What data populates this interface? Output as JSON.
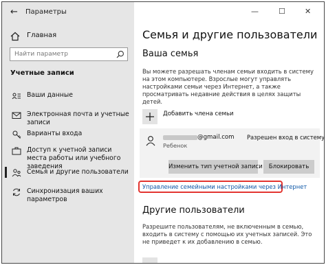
{
  "window": {
    "title": "Параметры",
    "controls": {
      "minimize": "—",
      "maximize": "☐",
      "close": "✕"
    }
  },
  "sidebar": {
    "home_label": "Главная",
    "search_placeholder": "Найти параметр",
    "section_label": "Учетные записи",
    "items": [
      {
        "label": "Ваши данные",
        "icon": "person-card-icon"
      },
      {
        "label": "Электронная почта и учетные записи",
        "icon": "mail-icon"
      },
      {
        "label": "Варианты входа",
        "icon": "key-icon"
      },
      {
        "label": "Доступ к учетной записи места работы или учебного заведения",
        "icon": "briefcase-icon"
      },
      {
        "label": "Семья и другие пользователи",
        "icon": "family-icon",
        "active": true
      },
      {
        "label": "Синхронизация ваших параметров",
        "icon": "sync-icon"
      }
    ]
  },
  "main": {
    "page_title": "Семья и другие пользователи",
    "family": {
      "heading": "Ваша семья",
      "description": "Вы можете разрешать членам семьи входить в систему на этом компьютере. Взрослые могут управлять настройками семьи через Интернет, а также просматривать недавние действия в целях защиты детей.",
      "add_member_label": "Добавить члена семьи",
      "member": {
        "email_domain": "@gmail.com",
        "role": "Ребенок",
        "status": "Разрешен вход в систему",
        "change_type_button": "Изменить тип учетной записи",
        "block_button": "Блокировать"
      },
      "manage_link": "Управление семейными настройками через Интернет"
    },
    "others": {
      "heading": "Другие пользователи",
      "description": "Разрешите пользователям, не включенным в семью, входить в систему с помощью их учетных записей. Это не приведет к их добавлению в семью."
    }
  }
}
